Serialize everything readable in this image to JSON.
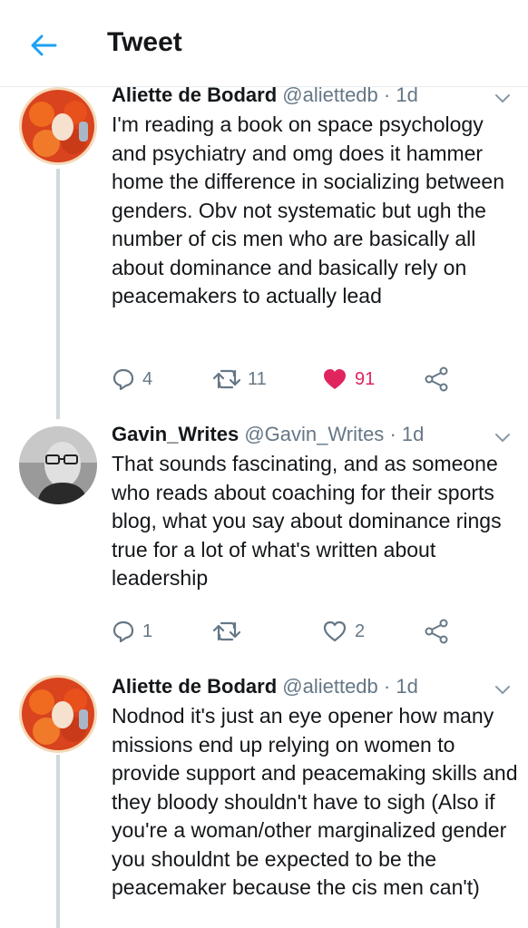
{
  "header": {
    "title": "Tweet"
  },
  "tweets": [
    {
      "name": "Aliette de Bodard",
      "handle": "@aliettedb",
      "sep": "·",
      "time": "1d",
      "text": "I'm reading a book on space psychology and psychiatry and omg does it hammer home the difference in socializing between genders. Obv not systematic but ugh the number of cis men who are basically all about dominance and basically rely on peacemakers to actually lead",
      "replies": "4",
      "retweets": "11",
      "likes": "91",
      "liked": true
    },
    {
      "name": "Gavin_Writes",
      "handle": "@Gavin_Writes",
      "sep": "·",
      "time": "1d",
      "text": "That sounds fascinating, and as someone who reads about coaching for their sports blog, what you say about dominance rings true for a lot of what's written about leadership",
      "replies": "1",
      "retweets": "",
      "likes": "2",
      "liked": false
    },
    {
      "name": "Aliette de Bodard",
      "handle": "@aliettedb",
      "sep": "·",
      "time": "1d",
      "text": "Nodnod it's just an eye opener how many missions end up relying on women to provide support and peacemaking skills and they bloody shouldn't have to sigh (Also if you're a woman/other marginalized gender you shouldnt be expected to be the peacemaker because the cis men can't)"
    }
  ],
  "colors": {
    "accent": "#1da1f2",
    "like": "#e0245e",
    "muted": "#657786",
    "line": "#cfd9de"
  }
}
